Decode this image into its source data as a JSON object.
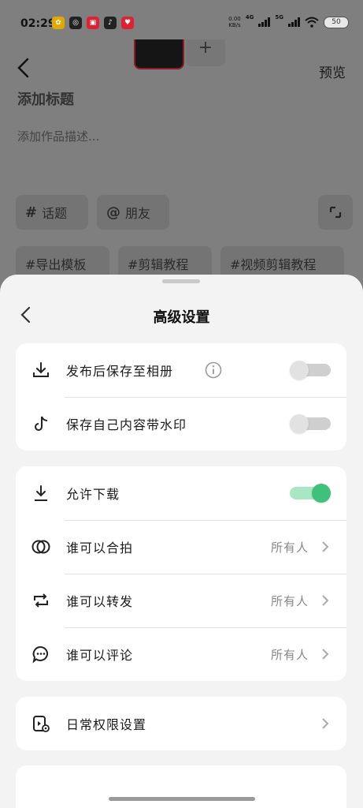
{
  "status_bar": {
    "time": "02:29",
    "speed_value": "0.00",
    "speed_unit": "KB/s",
    "net1": "4G",
    "net2": "5G",
    "battery": "50"
  },
  "background_page": {
    "preview_label": "预览",
    "title_placeholder": "添加标题",
    "description_placeholder": "添加作品描述...",
    "topic_chip": "话题",
    "topic_symbol": "#",
    "friend_chip": "朋友",
    "friend_symbol": "@",
    "tags": [
      "#导出模板",
      "#剪辑教程",
      "#视频剪辑教程"
    ]
  },
  "sheet": {
    "title": "高级设置",
    "group1": [
      {
        "label": "发布后保存至相册",
        "icon": "download-icon",
        "toggle": "off"
      },
      {
        "label": "保存自己内容带水印",
        "icon": "tiktok-icon",
        "toggle": "off"
      }
    ],
    "group2": [
      {
        "label": "允许下载",
        "icon": "download-icon",
        "toggle": "on"
      },
      {
        "label": "谁可以合拍",
        "icon": "duet-icon",
        "value": "所有人"
      },
      {
        "label": "谁可以转发",
        "icon": "repost-icon",
        "value": "所有人"
      },
      {
        "label": "谁可以评论",
        "icon": "comment-icon",
        "value": "所有人"
      }
    ],
    "group3": [
      {
        "label": "日常权限设置",
        "icon": "permission-settings-icon"
      }
    ]
  },
  "colors": {
    "toggle_on": "#3ec27b",
    "toggle_off": "#cfcfcf",
    "sheet_bg": "#f3f3f3",
    "dim_overlay": "#7f7f7f"
  }
}
